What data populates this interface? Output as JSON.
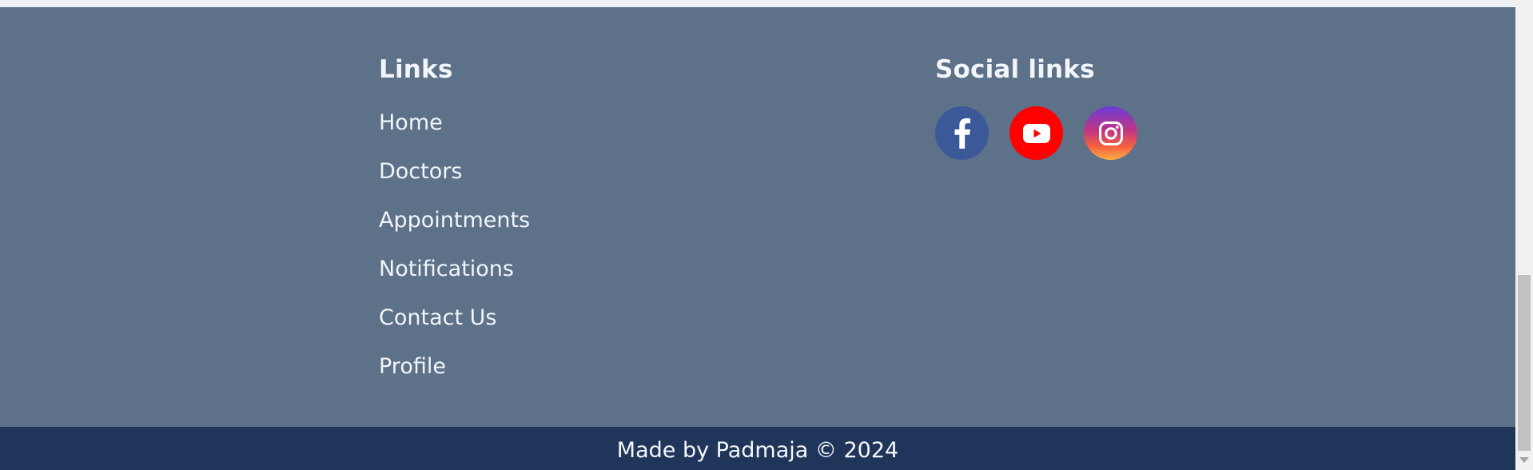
{
  "links_section": {
    "heading": "Links",
    "items": [
      {
        "label": "Home"
      },
      {
        "label": "Doctors"
      },
      {
        "label": "Appointments"
      },
      {
        "label": "Notifications"
      },
      {
        "label": "Contact Us"
      },
      {
        "label": "Profile"
      }
    ]
  },
  "social_section": {
    "heading": "Social links",
    "buttons": [
      {
        "icon": "facebook-icon",
        "color": "#3b5998"
      },
      {
        "icon": "youtube-icon",
        "color": "#ff0000"
      },
      {
        "icon": "instagram-icon",
        "color": "#c13584"
      }
    ]
  },
  "copyright": {
    "text": "Made by Padmaja © 2024"
  },
  "colors": {
    "footer_background": "#5d7189",
    "copyright_background": "#20355a",
    "text": "#f2f5fa"
  }
}
